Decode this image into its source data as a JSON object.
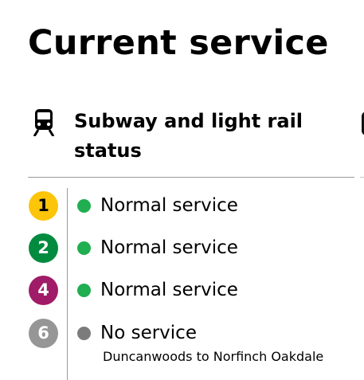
{
  "page": {
    "title": "Current service"
  },
  "section": {
    "icon": "subway-train-icon",
    "title": "Subway and light rail status"
  },
  "lines": [
    {
      "number": "1",
      "badge_color": "#fcc50a",
      "badge_text_color": "#000000",
      "status": "Normal service",
      "status_color": "#1fae50",
      "note": ""
    },
    {
      "number": "2",
      "badge_color": "#008b3f",
      "badge_text_color": "#ffffff",
      "status": "Normal service",
      "status_color": "#1fae50",
      "note": ""
    },
    {
      "number": "4",
      "badge_color": "#a01b68",
      "badge_text_color": "#ffffff",
      "status": "Normal service",
      "status_color": "#1fae50",
      "note": ""
    },
    {
      "number": "6",
      "badge_color": "#969696",
      "badge_text_color": "#ffffff",
      "status": "No service",
      "status_color": "#7c7c7c",
      "note": "Duncanwoods to Norfinch Oakdale"
    }
  ]
}
